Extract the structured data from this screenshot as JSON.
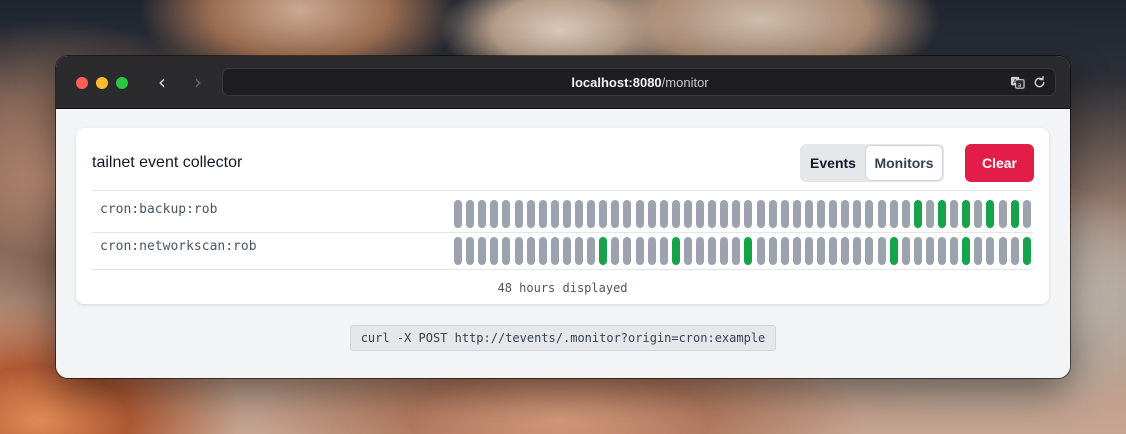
{
  "browser": {
    "url_host": "localhost:8080",
    "url_path": "/monitor"
  },
  "app": {
    "title": "tailnet event collector",
    "tabs": [
      {
        "label": "Events",
        "active": false
      },
      {
        "label": "Monitors",
        "active": true
      }
    ],
    "clear_label": "Clear",
    "colors": {
      "up": "#16a34a",
      "none": "#9ca3af",
      "clear": "#e11d48"
    },
    "monitors": [
      {
        "name": "cron:backup:rob",
        "hours": [
          0,
          0,
          0,
          0,
          0,
          0,
          0,
          0,
          0,
          0,
          0,
          0,
          0,
          0,
          0,
          0,
          0,
          0,
          0,
          0,
          0,
          0,
          0,
          0,
          0,
          0,
          0,
          0,
          0,
          0,
          0,
          0,
          0,
          0,
          0,
          0,
          0,
          0,
          1,
          0,
          1,
          0,
          1,
          0,
          1,
          0,
          1,
          0
        ]
      },
      {
        "name": "cron:networkscan:rob",
        "hours": [
          0,
          0,
          0,
          0,
          0,
          0,
          0,
          0,
          0,
          0,
          0,
          0,
          1,
          0,
          0,
          0,
          0,
          0,
          1,
          0,
          0,
          0,
          0,
          0,
          1,
          0,
          0,
          0,
          0,
          0,
          0,
          0,
          0,
          0,
          0,
          0,
          1,
          0,
          0,
          0,
          0,
          0,
          1,
          0,
          0,
          0,
          0,
          1
        ]
      }
    ],
    "footer": "48 hours displayed",
    "curl_command": "curl -X POST http://tevents/.monitor?origin=cron:example"
  }
}
